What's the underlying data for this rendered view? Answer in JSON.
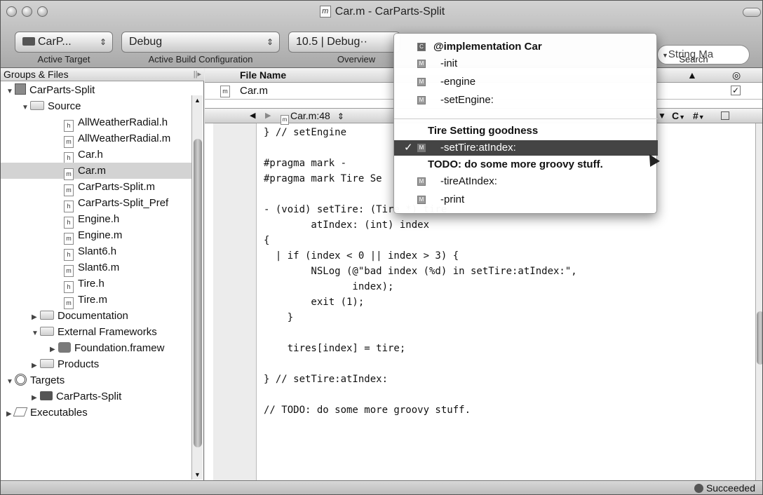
{
  "window": {
    "title": "Car.m - CarParts-Split"
  },
  "toolbar": {
    "target_label": "CarP...",
    "config_label": "Debug",
    "overview_label": "10.5 | Debug··",
    "search_placeholder": "String Ma",
    "labels": {
      "active_target": "Active Target",
      "active_build_configuration": "Active Build Configuration",
      "overview": "Overview",
      "search": "Search"
    }
  },
  "sidebar": {
    "header": "Groups & Files",
    "items": [
      {
        "label": "CarParts-Split"
      },
      {
        "label": "Source"
      },
      {
        "label": "AllWeatherRadial.h",
        "badge": "h"
      },
      {
        "label": "AllWeatherRadial.m",
        "badge": "m"
      },
      {
        "label": "Car.h",
        "badge": "h"
      },
      {
        "label": "Car.m",
        "badge": "m"
      },
      {
        "label": "CarParts-Split.m",
        "badge": "m"
      },
      {
        "label": "CarParts-Split_Pref",
        "badge": "h"
      },
      {
        "label": "Engine.h",
        "badge": "h"
      },
      {
        "label": "Engine.m",
        "badge": "m"
      },
      {
        "label": "Slant6.h",
        "badge": "h"
      },
      {
        "label": "Slant6.m",
        "badge": "m"
      },
      {
        "label": "Tire.h",
        "badge": "h"
      },
      {
        "label": "Tire.m",
        "badge": "m"
      },
      {
        "label": "Documentation"
      },
      {
        "label": "External Frameworks"
      },
      {
        "label": "Foundation.framew"
      },
      {
        "label": "Products"
      },
      {
        "label": "Targets"
      },
      {
        "label": "CarParts-Split"
      },
      {
        "label": "Executables"
      }
    ]
  },
  "filelist": {
    "header": "File Name",
    "file": "Car.m"
  },
  "navbar": {
    "file_position": "Car.m:48",
    "c_menu": "C",
    "hash_menu": "#"
  },
  "editor": {
    "lines": [
      "} // setEngine",
      "",
      "#pragma mark -",
      "#pragma mark Tire Se",
      "",
      "- (void) setTire: (Tire *) tire",
      "        atIndex: (int) index",
      "{",
      "  | if (index < 0 || index > 3) {",
      "        NSLog (@\"bad index (%d) in setTire:atIndex:\",",
      "               index);",
      "        exit (1);",
      "    }",
      "",
      "    tires[index] = tire;",
      "",
      "} // setTire:atIndex:",
      "",
      "// TODO: do some more groovy stuff."
    ]
  },
  "popup": {
    "impl_header": "@implementation Car",
    "methods_a": [
      "-init",
      "-engine",
      "-setEngine:"
    ],
    "group_header": "Tire Setting goodness",
    "selected": "-setTire:atIndex:",
    "todo_header": "TODO: do some more groovy stuff.",
    "methods_b": [
      "-tireAtIndex:",
      "-print"
    ]
  },
  "status": {
    "text": "Succeeded"
  }
}
